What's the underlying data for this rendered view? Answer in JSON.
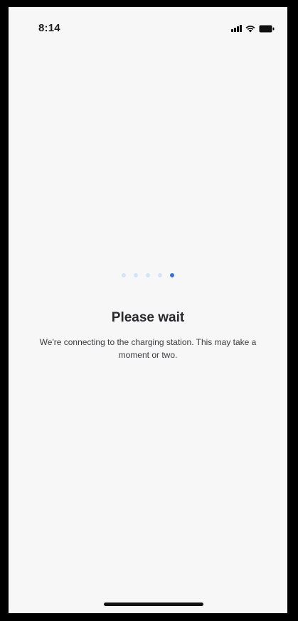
{
  "status_bar": {
    "time": "8:14",
    "icons": [
      "cellular-signal-icon",
      "wifi-icon",
      "battery-icon"
    ]
  },
  "loader": {
    "dot_count": 5,
    "active_index": 4,
    "inactive_color": "#d6e2f5",
    "active_color": "#3b6fe0"
  },
  "content": {
    "title": "Please wait",
    "message": "We're connecting to the charging station. This may take a moment or two."
  },
  "colors": {
    "background": "#f7f7f7",
    "frame": "#000000"
  }
}
